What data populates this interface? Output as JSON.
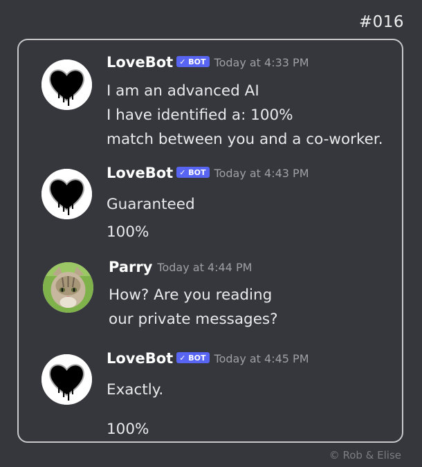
{
  "comic_number": "#016",
  "copyright": "©  Rob & Elise",
  "messages": [
    {
      "username": "LoveBot",
      "bot_tag": "✓ BOT",
      "timestamp": "Today at 4:33 PM",
      "lines": [
        "I am an advanced AI",
        "I have identified a: 100%",
        "match between you and a co-worker."
      ],
      "avatar_icon": "heart-icon"
    },
    {
      "username": "LoveBot",
      "bot_tag": "✓ BOT",
      "timestamp": "Today at 4:43 PM",
      "lines": [
        "Guaranteed",
        "100%"
      ],
      "avatar_icon": "heart-icon"
    },
    {
      "username": "Parry",
      "timestamp": "Today at 4:44 PM",
      "lines": [
        "How?  Are you reading",
        "our private messages?"
      ],
      "avatar_icon": "cat-photo"
    },
    {
      "username": "LoveBot",
      "bot_tag": "✓ BOT",
      "timestamp": "Today at 4:45 PM",
      "lines": [
        "Exactly.",
        "100%"
      ],
      "avatar_icon": "heart-icon"
    }
  ],
  "colors": {
    "background": "#36373c",
    "bot_tag": "#5865f2",
    "timestamp": "#9ea0a6"
  }
}
